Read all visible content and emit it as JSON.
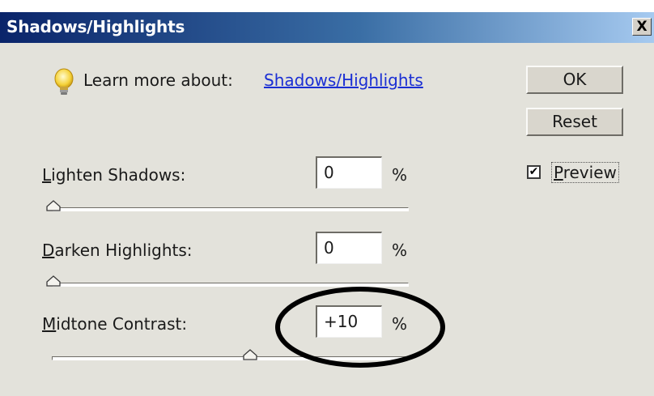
{
  "window": {
    "title": "Shadows/Highlights",
    "close_glyph": "X"
  },
  "learn": {
    "label": "Learn more about:",
    "link": "Shadows/Highlights",
    "icon": "lightbulb-icon"
  },
  "buttons": {
    "ok": "OK",
    "reset": "Reset"
  },
  "preview": {
    "label": "Preview",
    "checked": true
  },
  "fields": [
    {
      "label_first": "L",
      "label_rest": "ighten Shadows:",
      "value": "0",
      "unit": "%",
      "slider_value": 0,
      "slider_min": 0,
      "slider_max": 100
    },
    {
      "label_first": "D",
      "label_rest": "arken Highlights:",
      "value": "0",
      "unit": "%",
      "slider_value": 0,
      "slider_min": 0,
      "slider_max": 100
    },
    {
      "label_first": "M",
      "label_rest": "idtone Contrast:",
      "value": "+10",
      "unit": "%",
      "slider_value": 10,
      "slider_min": -100,
      "slider_max": 100
    }
  ],
  "colors": {
    "dialog_bg": "#e3e2db",
    "title_gradient_start": "#0a246a",
    "title_gradient_end": "#a6caf0",
    "link": "#1b2fd4"
  }
}
